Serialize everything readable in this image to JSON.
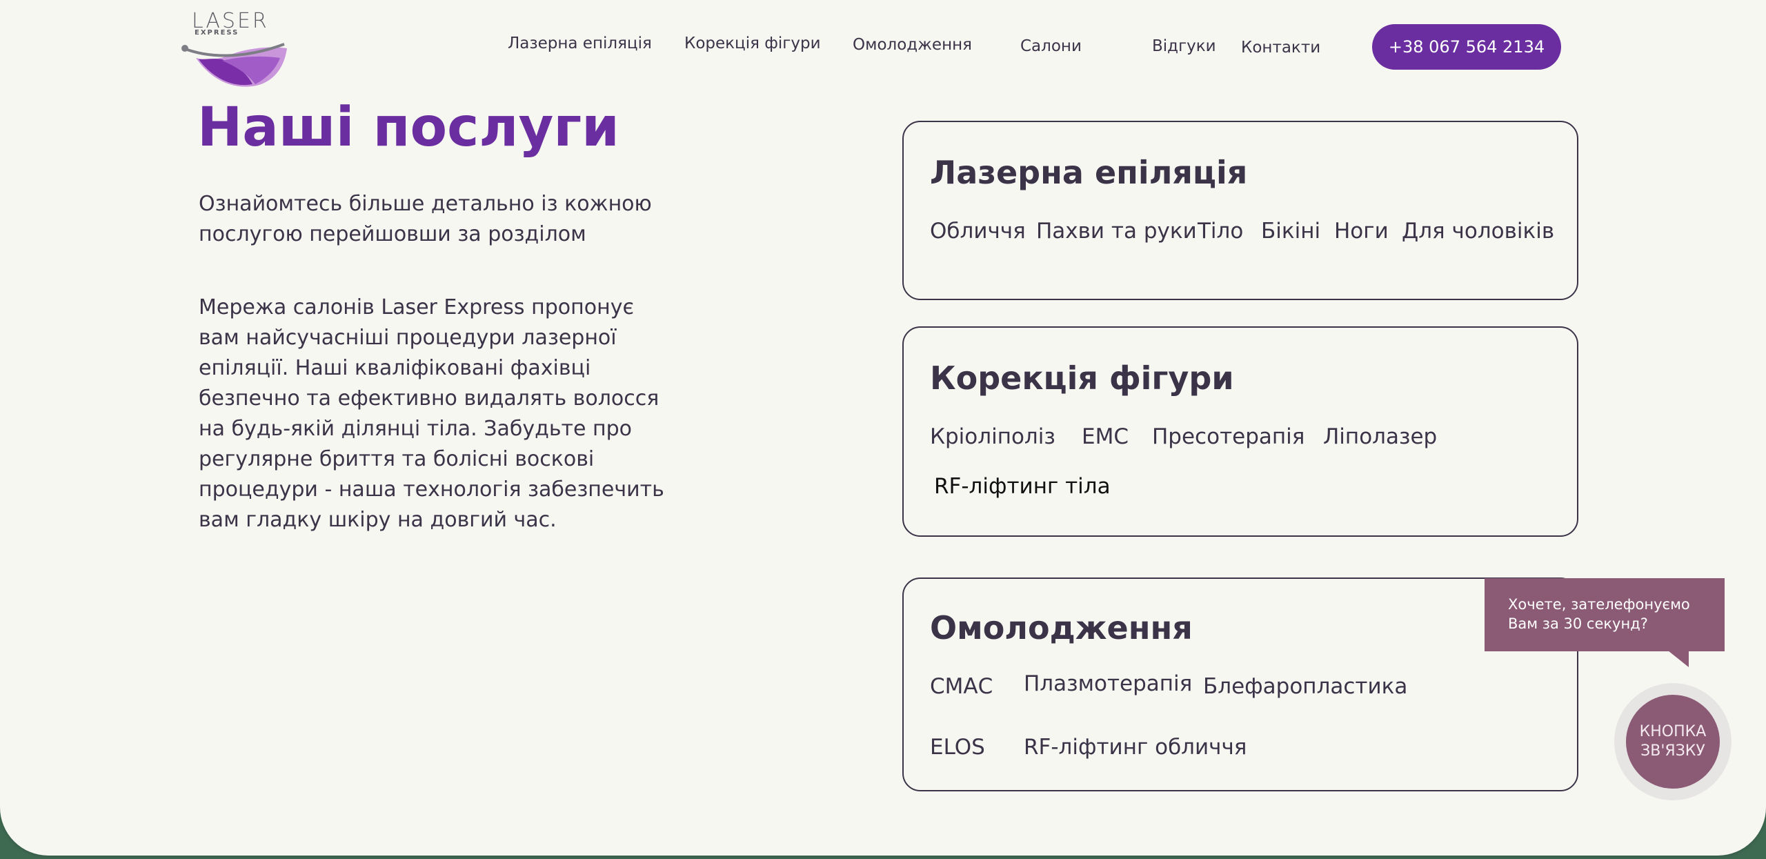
{
  "logo": {
    "main": "LASER",
    "sub": "EXPRESS",
    "colors": [
      "#6b2ea0",
      "#a15cc8",
      "#c996dc"
    ]
  },
  "nav": [
    {
      "label": "Лазерна епіляція"
    },
    {
      "label": "Корекція фігури"
    },
    {
      "label": "Омолодження"
    },
    {
      "label": "Салони"
    },
    {
      "label": "Відгуки"
    },
    {
      "label": "Контакти"
    }
  ],
  "phone": "+38 067 564 2134",
  "services": {
    "title": "Наші послуги",
    "intro": "Ознайомтесь більше детально із кожною послугою перейшовши за розділом",
    "description": "Мережа салонів Laser Express пропонує вам найсучасніші процедури лазерної епіляції. Наші кваліфіковані фахівці безпечно та ефективно видалять волосся на будь-якій ділянці тіла. Забудьте про регулярне бриття та болісні воскові процедури - наша технологія забезпечить вам гладку шкіру на довгий час."
  },
  "cards": [
    {
      "title": "Лазерна епіляція",
      "links": [
        "Обличчя",
        "Пахви та руки",
        "Тіло",
        "Бікіні",
        "Ноги",
        "Для чоловіків"
      ]
    },
    {
      "title": "Корекція фігури",
      "links": [
        "Кріоліполіз",
        "EMC",
        "Пресотерапія",
        "Ліполазер",
        "RF-ліфтинг тіла"
      ]
    },
    {
      "title": "Омолодження",
      "links": [
        "СМАС",
        "Плазмотерапія",
        "Блефаропластика",
        "ELOS",
        "RF-ліфтинг обличчя"
      ]
    }
  ],
  "callback": {
    "tooltip_line1": "Хочете, зателефонуємо",
    "tooltip_line2": "Вам за 30 секунд?",
    "button_line1": "КНОПКА",
    "button_line2": "ЗВ'ЯЗКУ"
  },
  "colors": {
    "accent": "#6b2ea0",
    "text": "#3b3347",
    "background": "#f7f7f2",
    "callback": "#8b5a74"
  }
}
